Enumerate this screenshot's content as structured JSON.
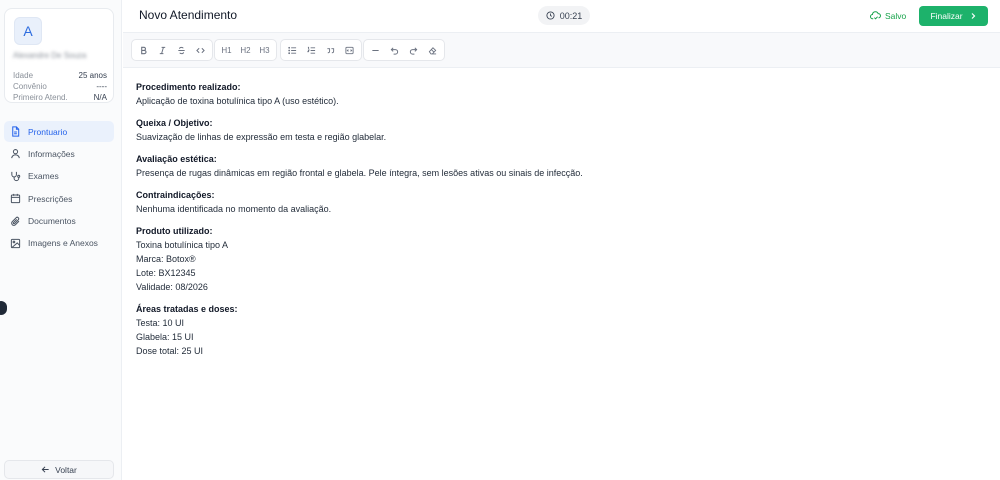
{
  "patient": {
    "initial": "A",
    "name": "Alexandre De Souza",
    "rows": [
      {
        "label": "Idade",
        "value": "25 anos"
      },
      {
        "label": "Convênio",
        "value": "----"
      },
      {
        "label": "Primeiro Atend.",
        "value": "N/A"
      }
    ]
  },
  "nav": [
    {
      "label": "Prontuario",
      "icon": "document-icon",
      "active": true
    },
    {
      "label": "Informações",
      "icon": "user-icon",
      "active": false
    },
    {
      "label": "Exames",
      "icon": "stethoscope-icon",
      "active": false
    },
    {
      "label": "Prescrições",
      "icon": "calendar-icon",
      "active": false
    },
    {
      "label": "Documentos",
      "icon": "paperclip-icon",
      "active": false
    },
    {
      "label": "Imagens e Anexos",
      "icon": "image-icon",
      "active": false
    }
  ],
  "back_label": "Voltar",
  "header": {
    "title": "Novo Atendimento",
    "timer": "00:21",
    "saved_label": "Salvo",
    "finalize_label": "Finalizar"
  },
  "toolbar": {
    "h1": "H1",
    "h2": "H2",
    "h3": "H3"
  },
  "document": [
    {
      "heading": "Procedimento realizado:",
      "lines": [
        "Aplicação de toxina botulínica tipo A (uso estético)."
      ]
    },
    {
      "heading": "Queixa / Objetivo:",
      "lines": [
        "Suavização de linhas de expressão em testa e região glabelar."
      ]
    },
    {
      "heading": "Avaliação estética:",
      "lines": [
        "Presença de rugas dinâmicas em região frontal e glabela. Pele íntegra, sem lesões ativas ou sinais de infecção."
      ]
    },
    {
      "heading": "Contraindicações:",
      "lines": [
        "Nenhuma identificada no momento da avaliação."
      ]
    },
    {
      "heading": "Produto utilizado:",
      "lines": [
        "Toxina botulínica tipo A",
        "Marca: Botox®",
        "Lote: BX12345",
        "Validade: 08/2026"
      ]
    },
    {
      "heading": "Áreas tratadas e doses:",
      "lines": [
        "Testa: 10 UI",
        "Glabela: 15 UI",
        "Dose total: 25 UI"
      ]
    }
  ],
  "colors": {
    "accent": "#2563eb",
    "success": "#1db26b",
    "saved": "#16a34a"
  }
}
